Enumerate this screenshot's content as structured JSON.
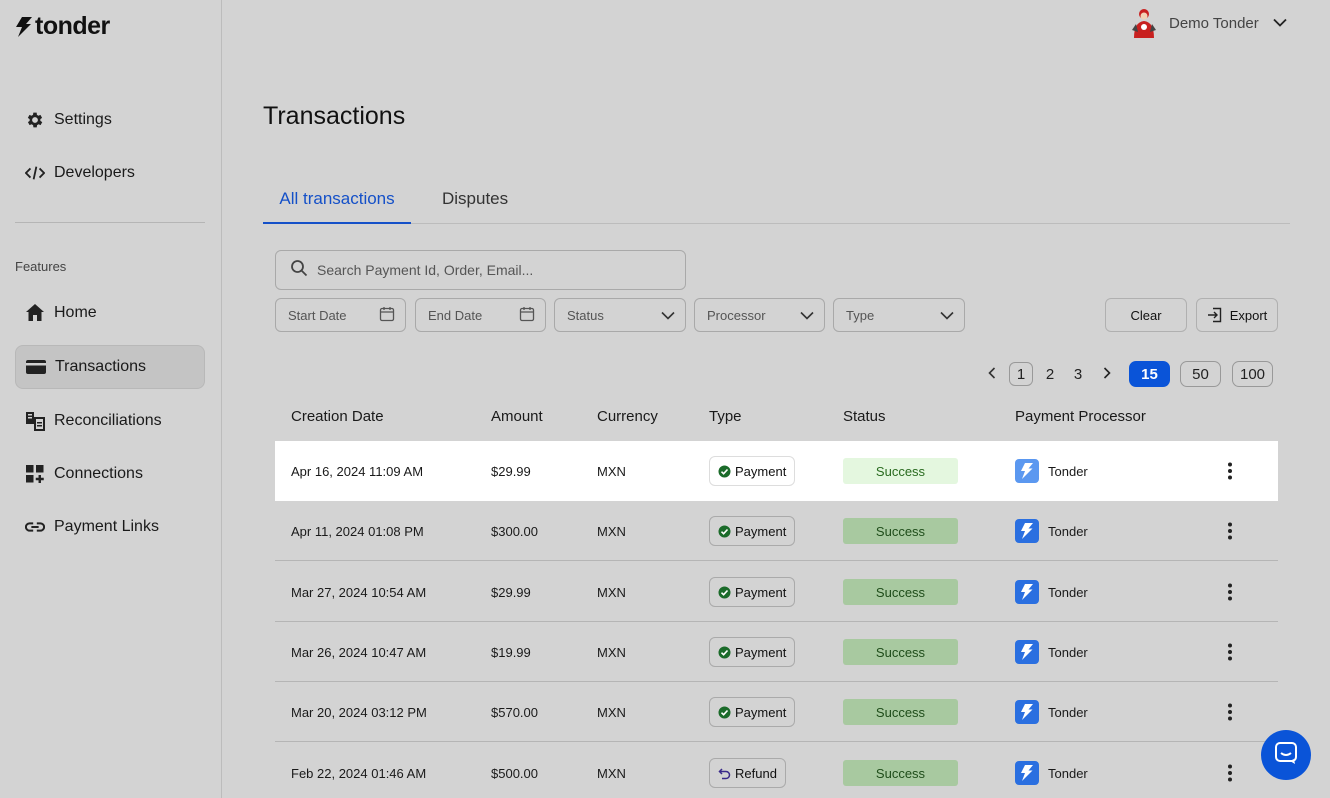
{
  "brand": {
    "logo_text": "tonder"
  },
  "user": {
    "name": "Demo Tonder"
  },
  "sidebar": {
    "top_items": [
      {
        "label": "Settings",
        "icon": "gear-icon"
      },
      {
        "label": "Developers",
        "icon": "code-icon"
      }
    ],
    "section_label": "Features",
    "items": [
      {
        "label": "Home",
        "icon": "home-icon"
      },
      {
        "label": "Transactions",
        "icon": "card-icon",
        "active": true
      },
      {
        "label": "Reconciliations",
        "icon": "reconcile-icon"
      },
      {
        "label": "Connections",
        "icon": "grid-plus-icon"
      },
      {
        "label": "Payment Links",
        "icon": "link-icon"
      }
    ]
  },
  "page": {
    "title": "Transactions"
  },
  "tabs": [
    {
      "label": "All transactions",
      "active": true
    },
    {
      "label": "Disputes",
      "active": false
    }
  ],
  "search": {
    "placeholder": "Search Payment Id, Order, Email..."
  },
  "filters": {
    "start_date": "Start Date",
    "end_date": "End Date",
    "status": "Status",
    "processor": "Processor",
    "type": "Type",
    "clear": "Clear",
    "export": "Export"
  },
  "pagination": {
    "pages": [
      "1",
      "2",
      "3"
    ],
    "current_page": "1",
    "page_sizes": [
      "15",
      "50",
      "100"
    ],
    "selected_size": "15"
  },
  "table": {
    "columns": [
      "Creation Date",
      "Amount",
      "Currency",
      "Type",
      "Status",
      "Payment Processor"
    ],
    "rows": [
      {
        "date": "Apr 16, 2024 11:09 AM",
        "amount": "$29.99",
        "currency": "MXN",
        "type": "Payment",
        "status": "Success",
        "processor": "Tonder"
      },
      {
        "date": "Apr 11, 2024 01:08 PM",
        "amount": "$300.00",
        "currency": "MXN",
        "type": "Payment",
        "status": "Success",
        "processor": "Tonder"
      },
      {
        "date": "Mar 27, 2024 10:54 AM",
        "amount": "$29.99",
        "currency": "MXN",
        "type": "Payment",
        "status": "Success",
        "processor": "Tonder"
      },
      {
        "date": "Mar 26, 2024 10:47 AM",
        "amount": "$19.99",
        "currency": "MXN",
        "type": "Payment",
        "status": "Success",
        "processor": "Tonder"
      },
      {
        "date": "Mar 20, 2024 03:12 PM",
        "amount": "$570.00",
        "currency": "MXN",
        "type": "Payment",
        "status": "Success",
        "processor": "Tonder"
      },
      {
        "date": "Feb 22, 2024 01:46 AM",
        "amount": "$500.00",
        "currency": "MXN",
        "type": "Refund",
        "status": "Success",
        "processor": "Tonder"
      }
    ]
  },
  "colors": {
    "accent": "#0a54d8",
    "tab_active": "#1450c8",
    "success_bg": "#a8c9a0"
  }
}
